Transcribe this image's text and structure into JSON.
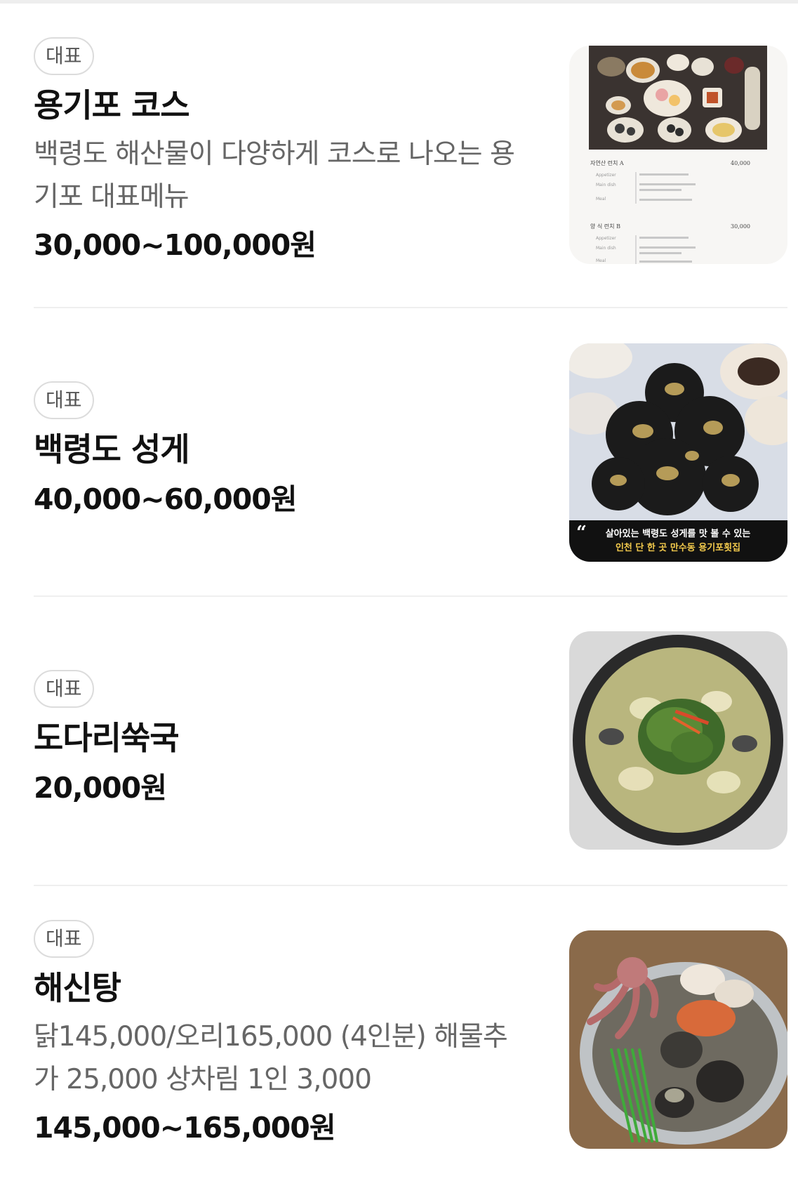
{
  "menu": {
    "items": [
      {
        "badge": "대표",
        "name": "용기포 코스",
        "description": "백령도 해산물이 다양하게 코스로 나오는 용기포 대표메뉴",
        "price": "30,000~100,000원",
        "image_alt": "course menu photo",
        "image_texts": {
          "lunch_a": "자연산 런치 A",
          "price_a": "40,000",
          "lunch_b": "양 식 런치 B",
          "price_b": "30,000",
          "appetizer": "Appetizer",
          "main_dish": "Main dish",
          "meal": "Meal"
        }
      },
      {
        "badge": "대표",
        "name": "백령도 성게",
        "description": "",
        "price": "40,000~60,000원",
        "image_alt": "sea urchin photo",
        "image_texts": {
          "caption_1": "살아있는 백령도 성게를 맛 볼 수 있는",
          "caption_2": "인천 단 한 곳 만수동 용기포횟집"
        }
      },
      {
        "badge": "대표",
        "name": "도다리쑥국",
        "description": "",
        "price": "20,000원",
        "image_alt": "flounder mugwort soup photo"
      },
      {
        "badge": "대표",
        "name": "해신탕",
        "description": "닭145,000/오리165,000 (4인분) 해물추가 25,000 상차림 1인 3,000",
        "price": "145,000~165,000원",
        "image_alt": "seafood hot pot photo"
      }
    ]
  }
}
